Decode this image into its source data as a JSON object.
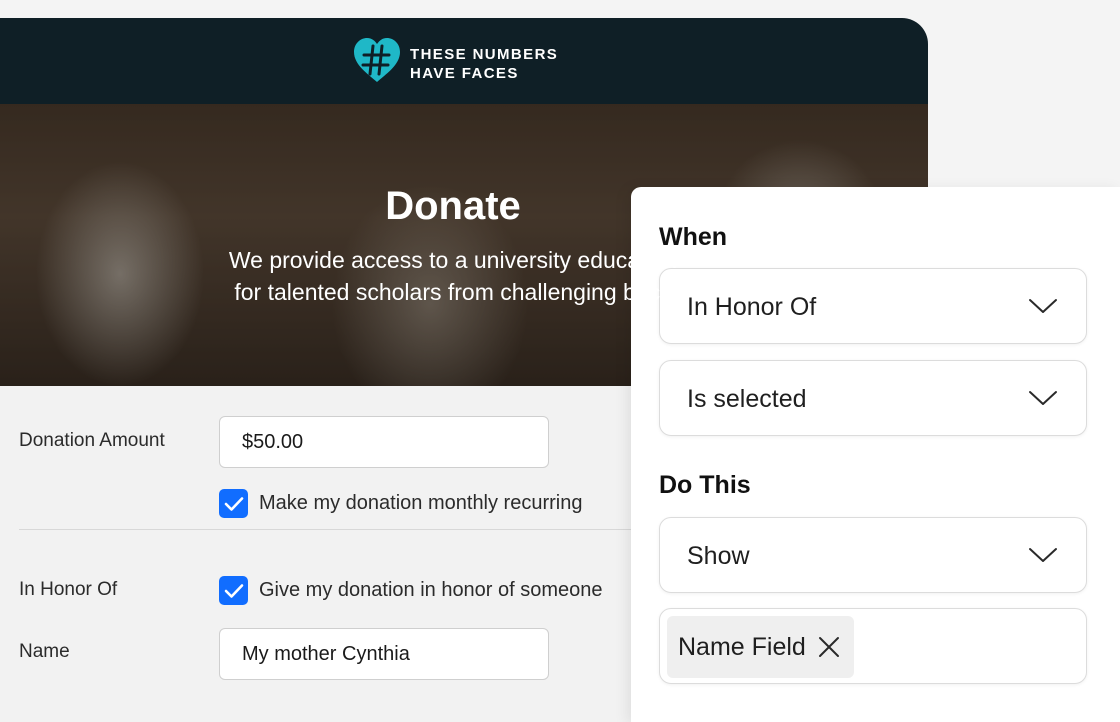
{
  "brand": {
    "line1": "THESE NUMBERS",
    "line2": "HAVE FACES",
    "color": "#1fb8c7"
  },
  "hero": {
    "title": "Donate",
    "subtitle_line1": "We provide access to a university education",
    "subtitle_line2": "for talented scholars from challenging back"
  },
  "form": {
    "donation_label": "Donation Amount",
    "donation_value": "$50.00",
    "recurring_label": "Make my donation monthly recurring",
    "recurring_checked": true,
    "honor_label": "In Honor Of",
    "honor_check_label": "Give my donation in honor of someone",
    "honor_checked": true,
    "name_label": "Name",
    "name_value": "My mother Cynthia",
    "accent": "#116dff"
  },
  "rule_panel": {
    "when_heading": "When",
    "when_field": "In Honor Of",
    "when_condition": "Is selected",
    "do_heading": "Do This",
    "do_action": "Show",
    "target_chip": "Name Field"
  },
  "icons": {
    "logo": "heart-hash-icon",
    "checkbox": "checkmark-icon",
    "dropdown": "chevron-down-icon",
    "chip_remove": "close-icon"
  }
}
